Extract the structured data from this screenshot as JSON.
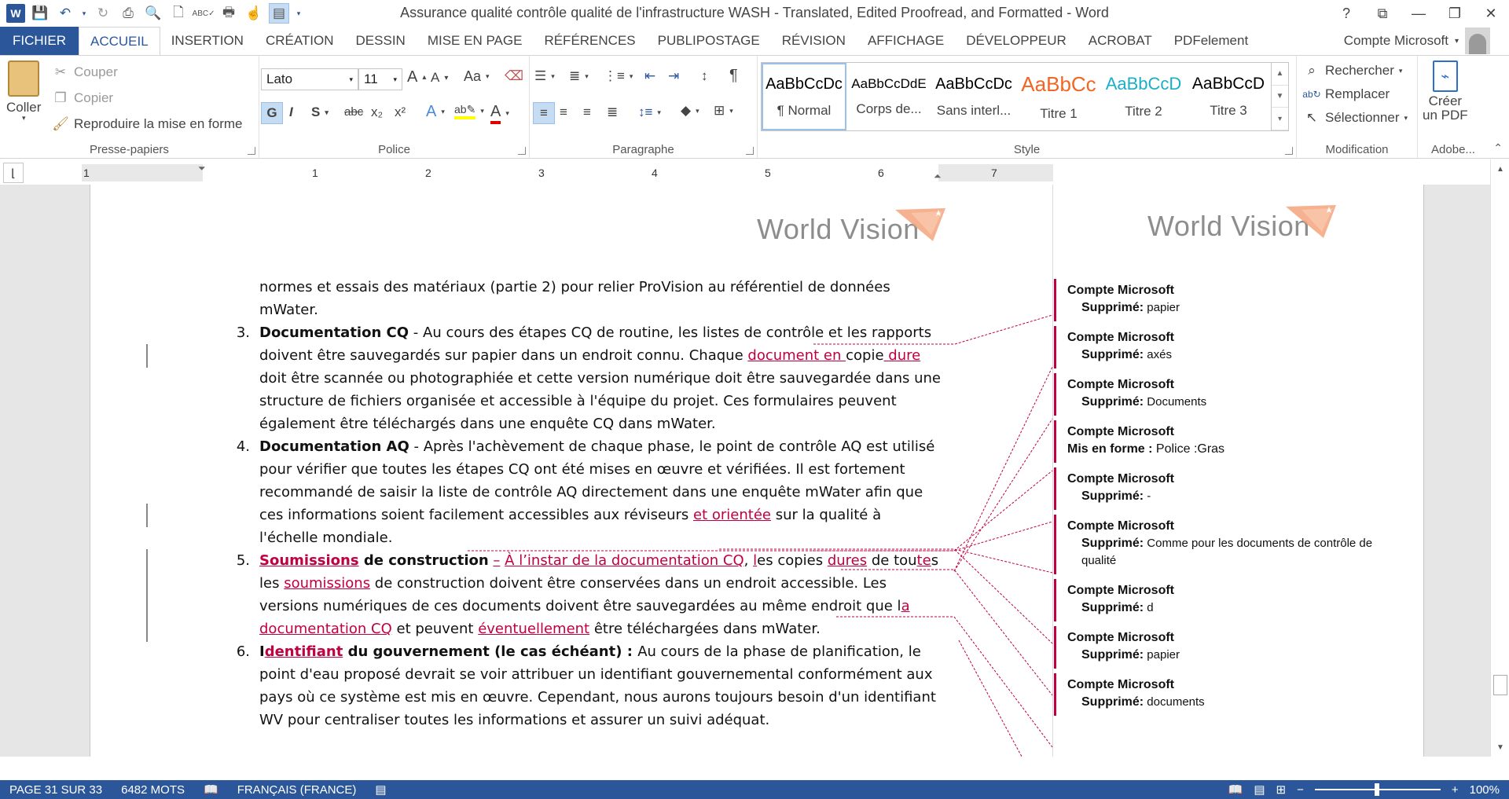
{
  "app": {
    "title": "Assurance qualité  contrôle qualité de l'infrastructure WASH - Translated, Edited Proofread, and Formatted - Word",
    "logo_text": "W",
    "window_controls": [
      "?",
      "⧉",
      "—",
      "❐",
      "✕"
    ]
  },
  "quick_access": [
    "save-icon",
    "undo-icon",
    "redo-icon",
    "print-icon",
    "print-preview-icon",
    "new-document-icon",
    "spelling-icon",
    "quick-print-icon",
    "touch-mode-icon",
    "view-icon"
  ],
  "tabs": [
    "FICHIER",
    "ACCUEIL",
    "INSERTION",
    "CRÉATION",
    "DESSIN",
    "MISE EN PAGE",
    "RÉFÉRENCES",
    "PUBLIPOSTAGE",
    "RÉVISION",
    "AFFICHAGE",
    "DÉVELOPPEUR",
    "ACROBAT",
    "PDFelement"
  ],
  "active_tab": "ACCUEIL",
  "account": "Compte Microsoft",
  "ribbon": {
    "clipboard": {
      "paste": "Coller",
      "cut": "Couper",
      "copy": "Copier",
      "format_painter": "Reproduire la mise en forme",
      "label": "Presse-papiers"
    },
    "font": {
      "name": "Lato",
      "size": "11",
      "label": "Police",
      "bold": "G",
      "italic": "I",
      "underline": "S",
      "strike": "abc",
      "subscript": "x₂",
      "superscript": "x²",
      "case": "Aa"
    },
    "paragraph": {
      "label": "Paragraphe"
    },
    "styles": {
      "label": "Style",
      "items": [
        {
          "preview": "AaBbCcDc",
          "name": "¶ Normal",
          "color": "#000000"
        },
        {
          "preview": "AaBbCcDdE",
          "name": "Corps de...",
          "color": "#000000"
        },
        {
          "preview": "AaBbCcDc",
          "name": "Sans interl...",
          "color": "#000000"
        },
        {
          "preview": "AaBbCc",
          "name": "Titre 1",
          "color": "#f26522"
        },
        {
          "preview": "AaBbCcD",
          "name": "Titre 2",
          "color": "#1aaec8"
        },
        {
          "preview": "AaBbCcD",
          "name": "Titre 3",
          "color": "#000000"
        }
      ]
    },
    "editing": {
      "label": "Modification",
      "find": "Rechercher",
      "replace": "Remplacer",
      "select": "Sélectionner"
    },
    "adobe": {
      "label": "Adobe...",
      "create_pdf_1": "Créer",
      "create_pdf_2": "un PDF"
    }
  },
  "ruler": {
    "numbers": [
      "1",
      "1",
      "2",
      "3",
      "4",
      "5",
      "6",
      "7"
    ]
  },
  "logo_text": "World Vision",
  "document": {
    "p0": "normes et essais des matériaux (partie 2) pour relier ProVision au référentiel de données mWater.",
    "items": [
      {
        "num": "3.",
        "segments": [
          {
            "t": "Documentation CQ",
            "s": "b"
          },
          {
            "t": " - Au cours des étapes CQ de routine, les listes de contrôle et les rapports doivent être sauvegardés sur papier dans un endroit connu. Chaque ",
            "s": ""
          },
          {
            "t": "document en ",
            "s": "ins"
          },
          {
            "t": "copie",
            "s": ""
          },
          {
            "t": " dure",
            "s": "ins"
          },
          {
            "t": " doit être scannée ou photographiée et cette version numérique doit être sauvegardée dans une structure de fichiers organisée et accessible à l'équipe du projet. Ces formulaires peuvent également être téléchargés dans une enquête CQ dans mWater.",
            "s": ""
          }
        ]
      },
      {
        "num": "4.",
        "segments": [
          {
            "t": "Documentation AQ",
            "s": "b"
          },
          {
            "t": " - Après l'achèvement de chaque phase, le point de contrôle AQ est utilisé pour vérifier que toutes les étapes CQ ont été mises en œuvre et vérifiées. Il est fortement recommandé de saisir la liste de contrôle AQ directement dans une enquête mWater afin que ces informations soient facilement accessibles aux réviseurs ",
            "s": ""
          },
          {
            "t": "et orientée",
            "s": "ins"
          },
          {
            "t": " sur la qualité à l'échelle mondiale.",
            "s": ""
          }
        ]
      },
      {
        "num": "5.",
        "segments": [
          {
            "t": "Soumissions",
            "s": "b ins"
          },
          {
            "t": " de construction",
            "s": "b"
          },
          {
            "t": " ",
            "s": ""
          },
          {
            "t": "–",
            "s": "ins"
          },
          {
            "t": " ",
            "s": ""
          },
          {
            "t": "À l’instar de la documentation CQ",
            "s": "ins"
          },
          {
            "t": ", ",
            "s": ""
          },
          {
            "t": "l",
            "s": "ins"
          },
          {
            "t": "es copies ",
            "s": ""
          },
          {
            "t": "dures",
            "s": "ins"
          },
          {
            "t": " de tou",
            "s": ""
          },
          {
            "t": "te",
            "s": "ins"
          },
          {
            "t": "s les ",
            "s": ""
          },
          {
            "t": "soumissions",
            "s": "ins"
          },
          {
            "t": " de construction doivent être conservées dans un endroit accessible. Les versions numériques de ces documents doivent être sauvegardées au même endroit que l",
            "s": ""
          },
          {
            "t": "a documentation CQ",
            "s": "ins"
          },
          {
            "t": " et peuvent ",
            "s": ""
          },
          {
            "t": "éventuellement",
            "s": "ins"
          },
          {
            "t": " être téléchargées dans mWater.",
            "s": ""
          }
        ]
      },
      {
        "num": "6.",
        "segments": [
          {
            "t": "I",
            "s": "b"
          },
          {
            "t": "dentifiant",
            "s": "b ins"
          },
          {
            "t": " du gouvernement (le cas échéant)",
            "s": "b"
          },
          {
            "t": " : ",
            "s": "b"
          },
          {
            "t": "Au cours de la phase de planification, le point d'eau proposé devrait se voir attribuer un identifiant gouvernemental conformément aux pays où ce système est mis en œuvre. Cependant, nous aurons toujours besoin d'un identifiant WV pour centraliser toutes les informations et assurer un suivi adéquat.",
            "s": ""
          }
        ]
      }
    ]
  },
  "comments": [
    {
      "author": "Compte Microsoft",
      "kind": "Supprimé:",
      "text": " papier",
      "indent": true
    },
    {
      "author": "Compte Microsoft",
      "kind": "Supprimé:",
      "text": " axés",
      "indent": true
    },
    {
      "author": "Compte Microsoft",
      "kind": "Supprimé:",
      "text": " Documents",
      "indent": true
    },
    {
      "author": "Compte Microsoft",
      "kind": "Mis en forme :",
      "text": " Police :Gras",
      "indent": false
    },
    {
      "author": "Compte Microsoft",
      "kind": "Supprimé:",
      "text": " -",
      "indent": true
    },
    {
      "author": "Compte Microsoft",
      "kind": "Supprimé:",
      "text": " Comme pour les documents de contrôle de qualité",
      "indent": true
    },
    {
      "author": "Compte Microsoft",
      "kind": "Supprimé:",
      "text": " d",
      "indent": true
    },
    {
      "author": "Compte Microsoft",
      "kind": "Supprimé:",
      "text": " papier",
      "indent": true
    },
    {
      "author": "Compte Microsoft",
      "kind": "Supprimé:",
      "text": " documents",
      "indent": true
    }
  ],
  "statusbar": {
    "page": "PAGE 31 SUR 33",
    "words": "6482 MOTS",
    "language": "FRANÇAIS (FRANCE)",
    "zoom": "100%"
  },
  "colors": {
    "accent": "#2b579a",
    "revision": "#c00040"
  }
}
